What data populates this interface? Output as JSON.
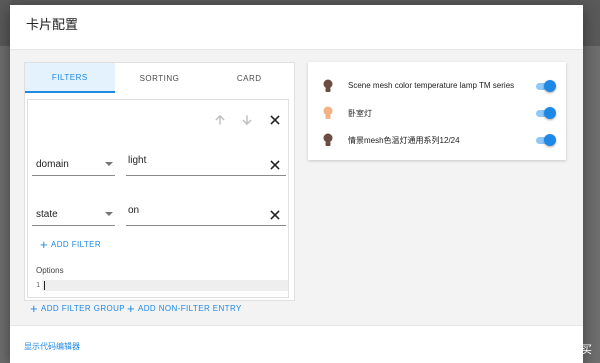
{
  "dialog": {
    "title": "卡片配置",
    "footer_link": "显示代码编辑器"
  },
  "editor": {
    "tabs": [
      {
        "label": "FILTERS",
        "active": true
      },
      {
        "label": "SORTING",
        "active": false
      },
      {
        "label": "CARD",
        "active": false
      }
    ],
    "filters": [
      {
        "field": "domain",
        "value": "light"
      },
      {
        "field": "state",
        "value": "on"
      }
    ],
    "add_filter_label": "ADD FILTER",
    "options_label": "Options",
    "code_line_number": "1",
    "add_filter_group_label": "ADD FILTER GROUP",
    "add_non_filter_entry_label": "ADD NON-FILTER ENTRY"
  },
  "preview": {
    "entities": [
      {
        "name": "Scene mesh color temperature lamp TM series",
        "bulb_color": "#6d4c41",
        "state": "on"
      },
      {
        "name": "卧室灯",
        "bulb_color": "#f4b183",
        "state": "on"
      },
      {
        "name": "情景mesh色温灯通用系列12/24",
        "bulb_color": "#6d4c41",
        "state": "on"
      }
    ]
  },
  "colors": {
    "accent": "#1e88e5",
    "toggle_track": "#8fc9f8"
  },
  "watermark": {
    "text": "值 什么值得买"
  }
}
